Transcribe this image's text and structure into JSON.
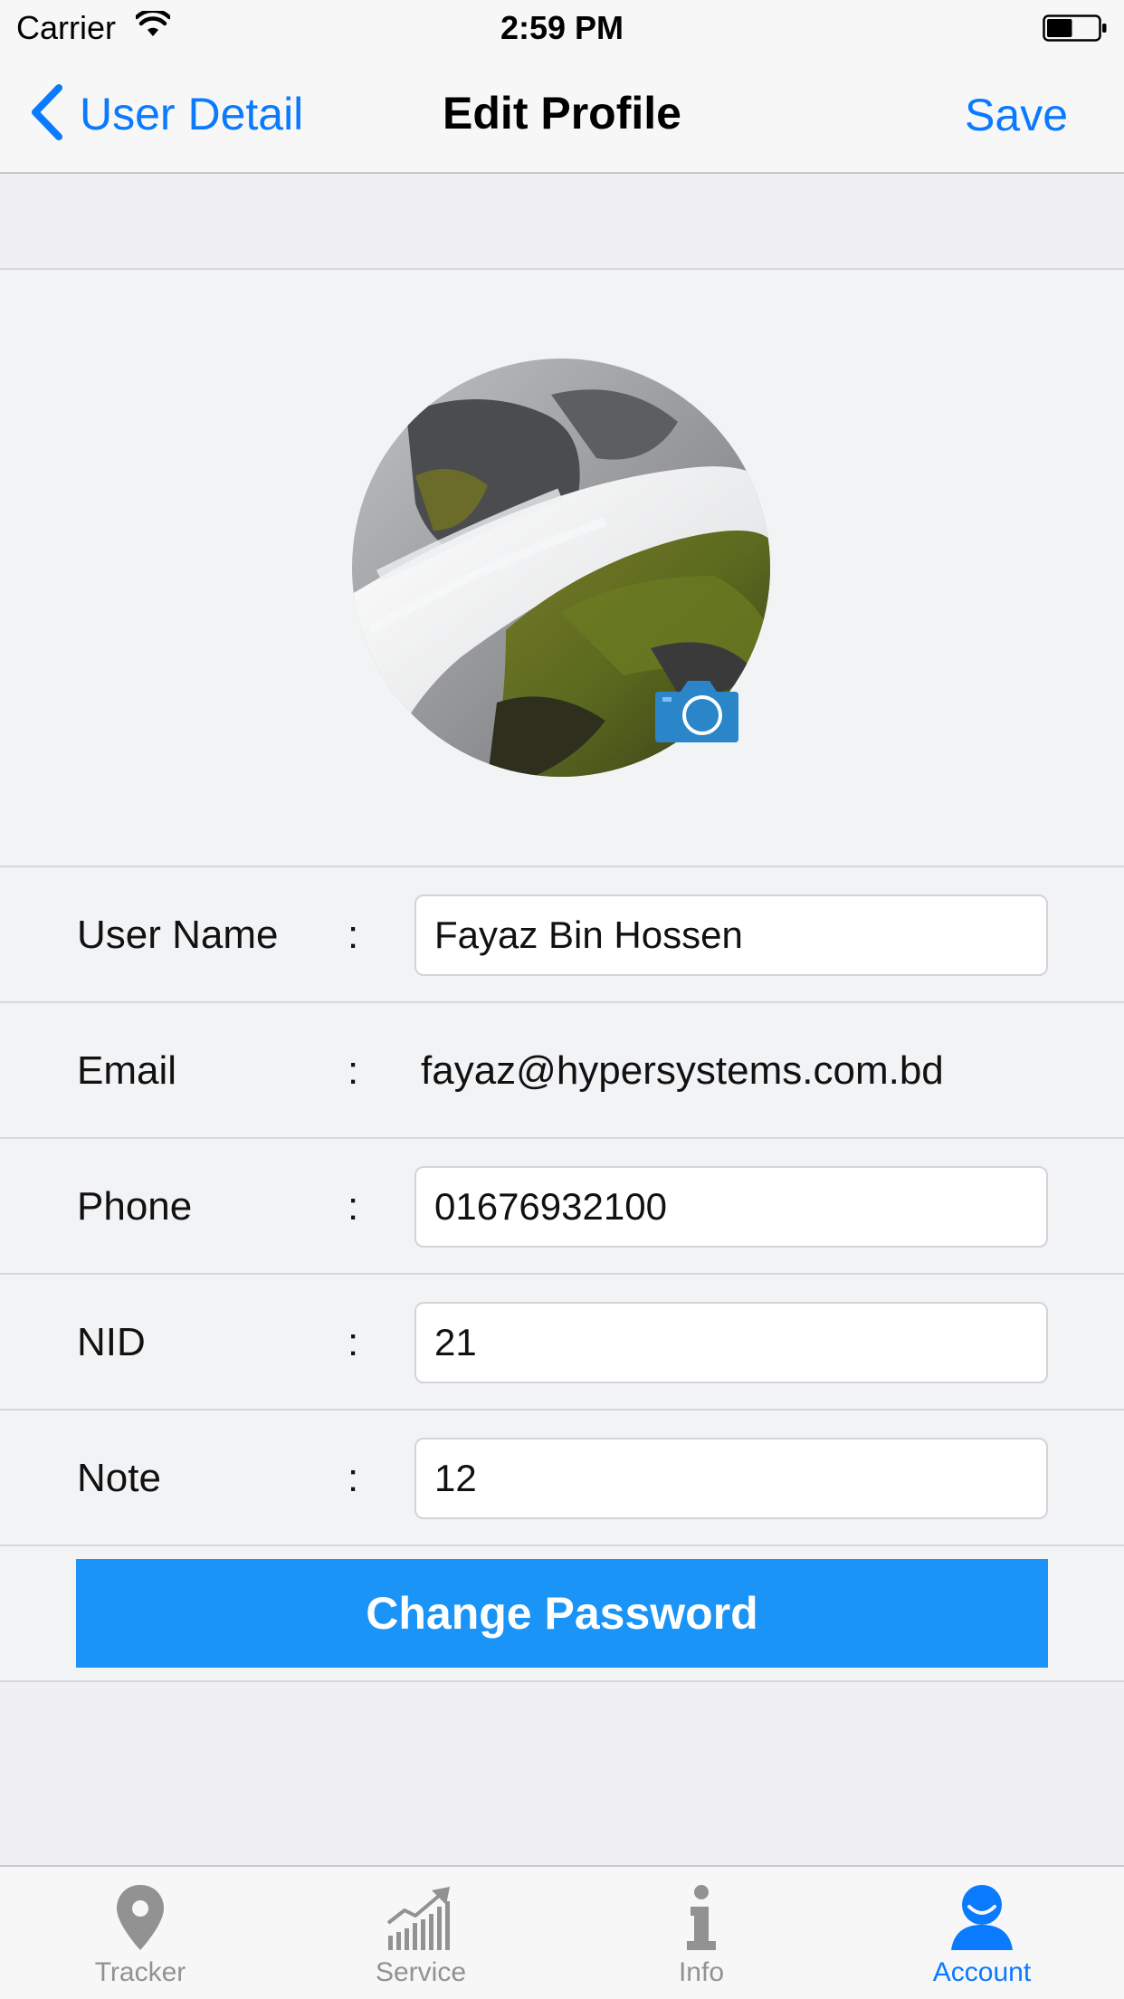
{
  "status_bar": {
    "carrier": "Carrier",
    "time": "2:59 PM",
    "battery_level": 0.5
  },
  "nav": {
    "back_label": "User Detail",
    "title": "Edit Profile",
    "save_label": "Save"
  },
  "profile": {
    "avatar_icon": "avatar-photo-waterfall",
    "camera_icon": "camera-icon"
  },
  "form": {
    "username": {
      "label": "User Name",
      "colon": ":",
      "value": "Fayaz Bin Hossen"
    },
    "email": {
      "label": "Email",
      "colon": ":",
      "value": "fayaz@hypersystems.com.bd"
    },
    "phone": {
      "label": "Phone",
      "colon": ":",
      "value": "01676932100"
    },
    "nid": {
      "label": "NID",
      "colon": ":",
      "value": "21"
    },
    "note": {
      "label": "Note",
      "colon": ":",
      "value": "12"
    }
  },
  "actions": {
    "change_password_label": "Change Password"
  },
  "tab_bar": {
    "items": [
      {
        "label": "Tracker",
        "icon": "location-pin-icon",
        "active": false
      },
      {
        "label": "Service",
        "icon": "chart-growth-icon",
        "active": false
      },
      {
        "label": "Info",
        "icon": "info-icon",
        "active": false
      },
      {
        "label": "Account",
        "icon": "user-icon",
        "active": true
      }
    ]
  },
  "colors": {
    "accent": "#0a7aff",
    "button": "#1a94f6",
    "inactive_tab": "#929292"
  }
}
